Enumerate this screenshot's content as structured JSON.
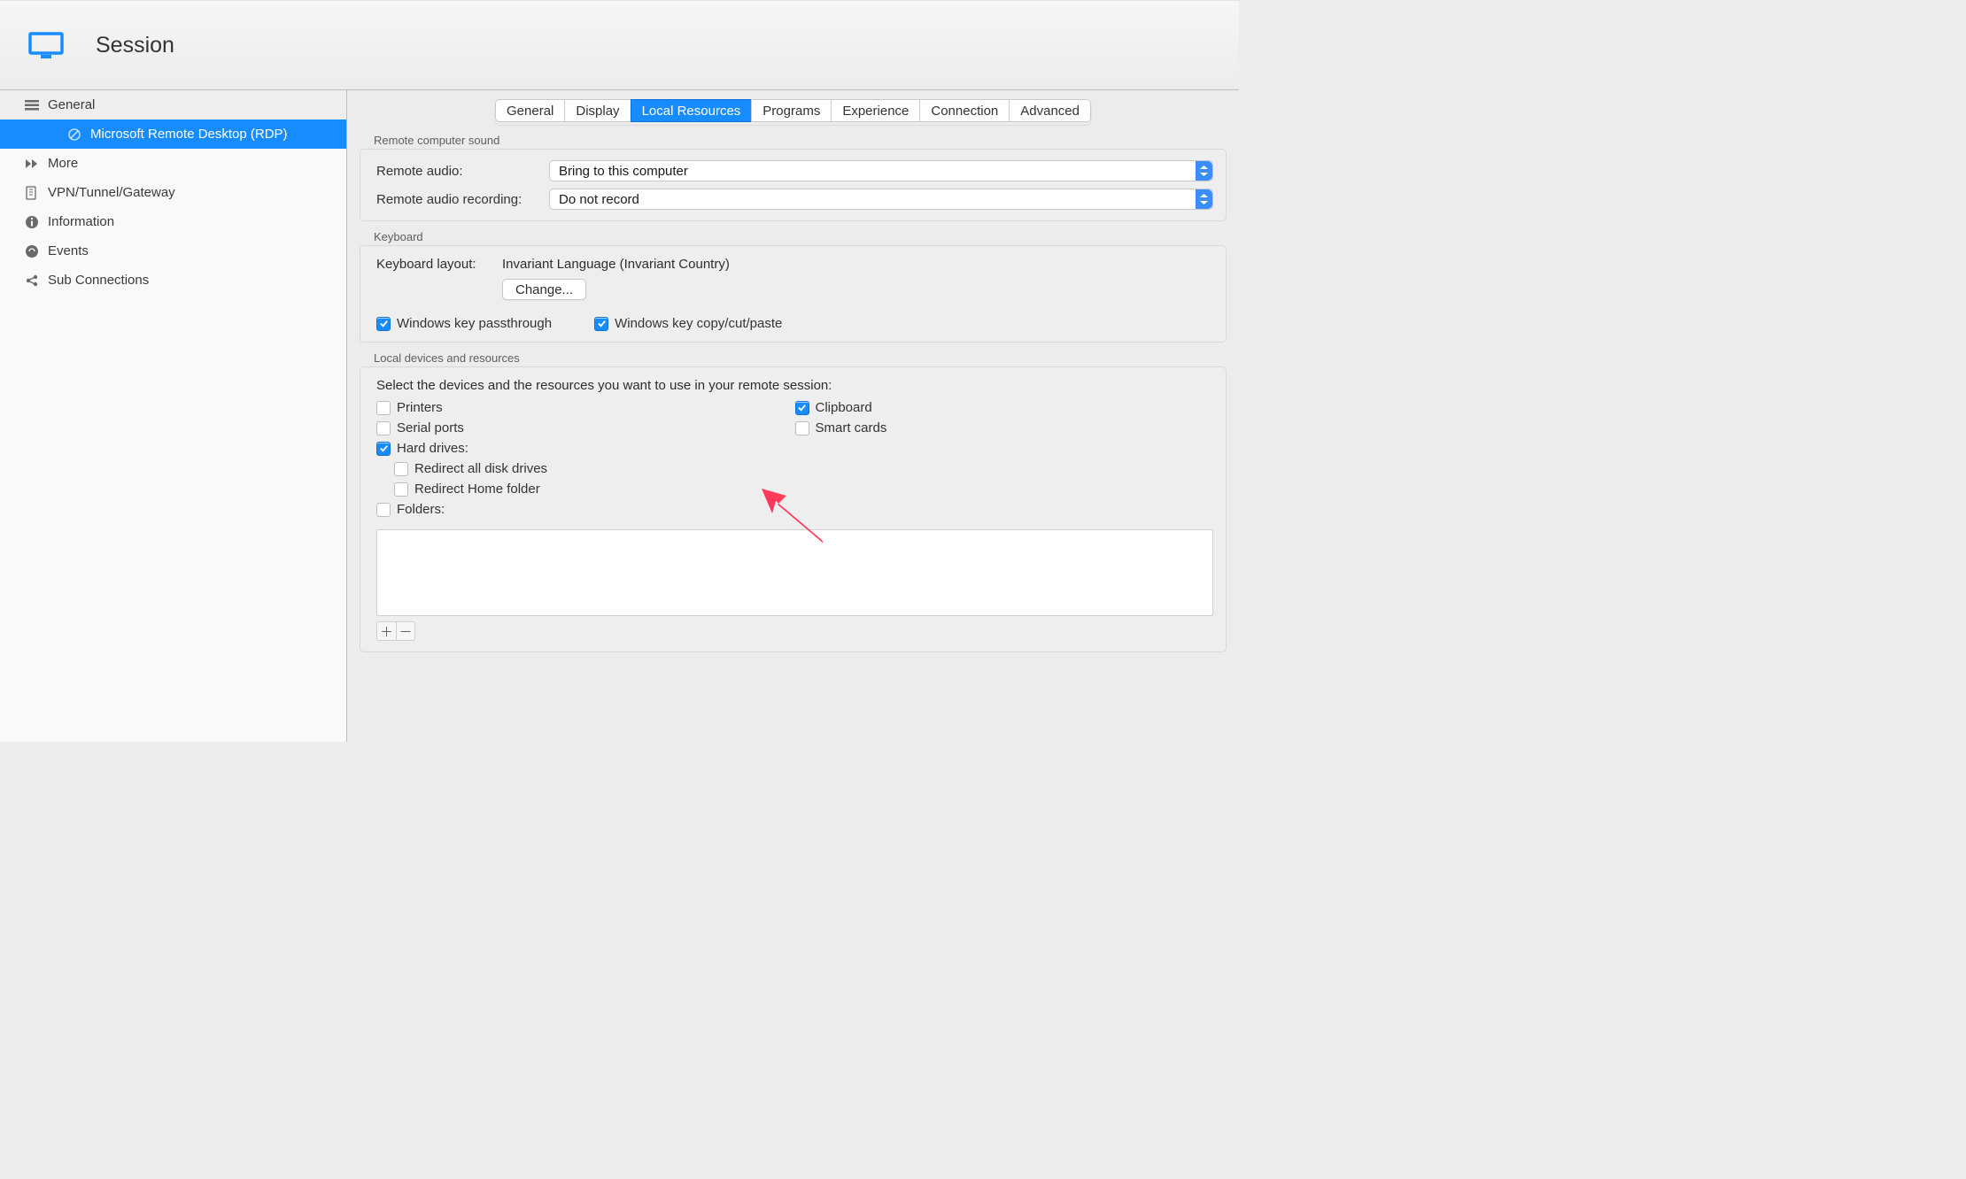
{
  "header": {
    "title": "Session"
  },
  "sidebar": {
    "items": [
      {
        "label": "General",
        "icon": "menu"
      },
      {
        "label": "Microsoft Remote Desktop (RDP)",
        "icon": "circle",
        "selected": true,
        "sub": true
      },
      {
        "label": "More",
        "icon": "more"
      },
      {
        "label": "VPN/Tunnel/Gateway",
        "icon": "gateway"
      },
      {
        "label": "Information",
        "icon": "info"
      },
      {
        "label": "Events",
        "icon": "events"
      },
      {
        "label": "Sub Connections",
        "icon": "share"
      }
    ]
  },
  "tabs": {
    "items": [
      "General",
      "Display",
      "Local Resources",
      "Programs",
      "Experience",
      "Connection",
      "Advanced"
    ],
    "active": "Local Resources"
  },
  "sound": {
    "section_label": "Remote computer sound",
    "audio_label": "Remote audio:",
    "audio_value": "Bring to this computer",
    "recording_label": "Remote audio recording:",
    "recording_value": "Do not record"
  },
  "keyboard": {
    "section_label": "Keyboard",
    "layout_label": "Keyboard layout:",
    "layout_value": "Invariant Language (Invariant Country)",
    "change_btn": "Change...",
    "passthrough": "Windows key passthrough",
    "copycut": "Windows key copy/cut/paste"
  },
  "devices": {
    "section_label": "Local devices and resources",
    "intro": "Select the devices and the resources you want to use in your remote session:",
    "col1": [
      {
        "label": "Printers",
        "checked": false
      },
      {
        "label": "Serial ports",
        "checked": false
      },
      {
        "label": "Hard drives:",
        "checked": true
      }
    ],
    "col1_sub": [
      {
        "label": "Redirect all disk drives",
        "checked": false
      },
      {
        "label": "Redirect Home folder",
        "checked": false
      }
    ],
    "folders": {
      "label": "Folders:",
      "checked": false
    },
    "col2": [
      {
        "label": "Clipboard",
        "checked": true
      },
      {
        "label": "Smart cards",
        "checked": false
      }
    ]
  }
}
